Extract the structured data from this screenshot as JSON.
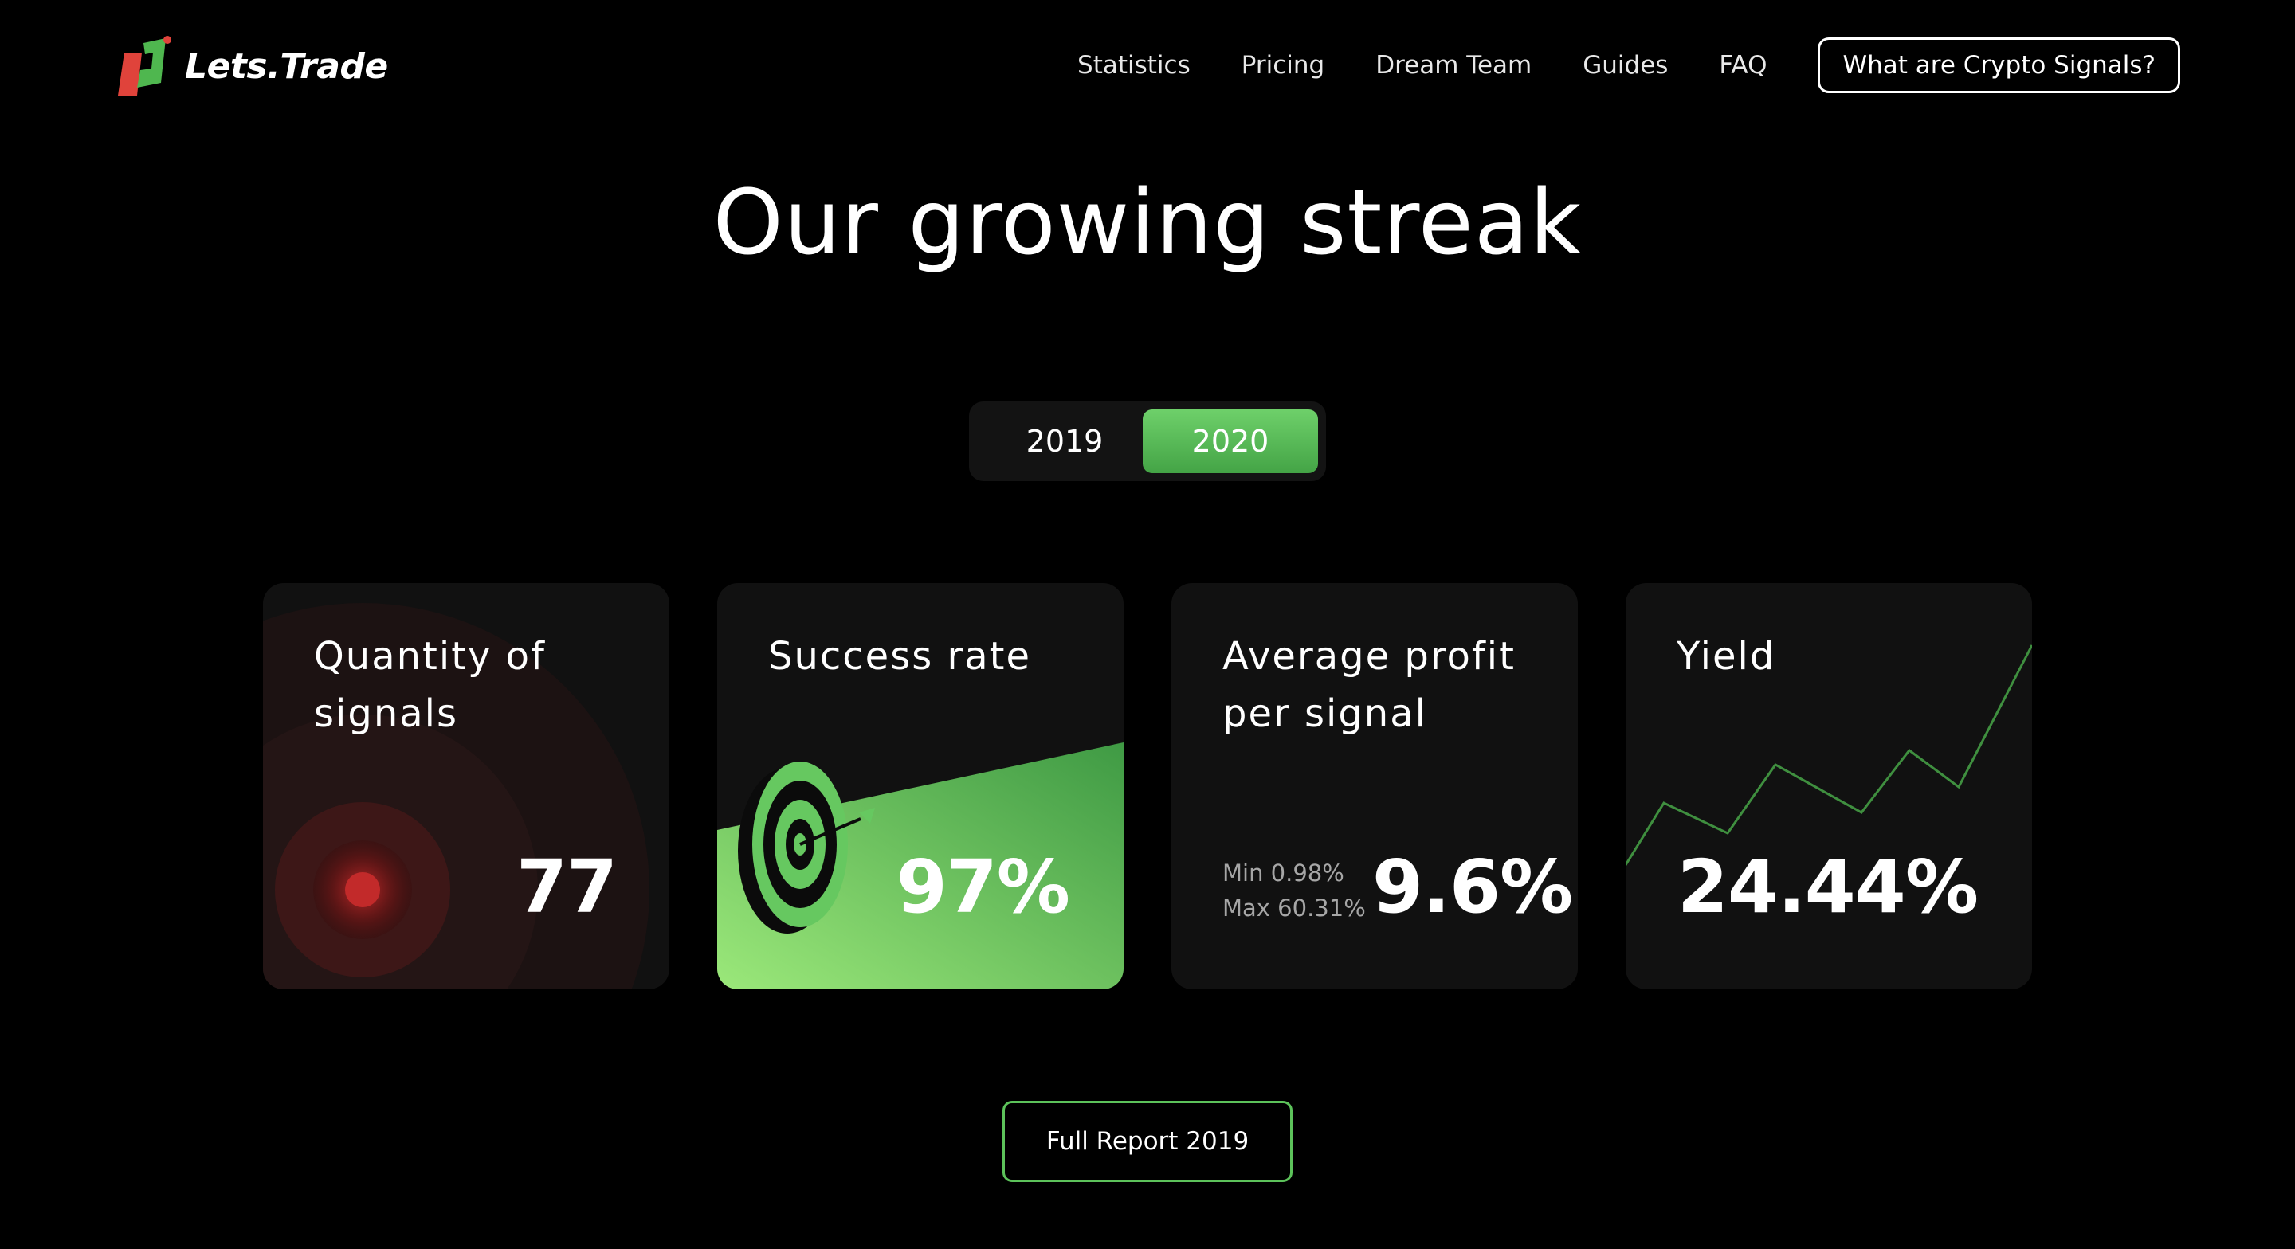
{
  "brand": {
    "name": "Lets.Trade"
  },
  "nav": {
    "links": [
      "Statistics",
      "Pricing",
      "Dream Team",
      "Guides",
      "FAQ"
    ],
    "cta": "What are Crypto Signals?"
  },
  "page_title": "Our growing streak",
  "years": {
    "options": [
      "2019",
      "2020"
    ],
    "selected": "2020"
  },
  "cards": [
    {
      "label": "Quantity of signals",
      "value": "77"
    },
    {
      "label": "Success rate",
      "value": "97%"
    },
    {
      "label": "Average profit per signal",
      "value": "9.6%",
      "min": "Min 0.98%",
      "max": "Max 60.31%"
    },
    {
      "label": "Yield",
      "value": "24.44%"
    }
  ],
  "report_button": "Full Report 2019",
  "colors": {
    "accent_green": "#5cc25a",
    "accent_red": "#e0433b",
    "background": "#000000",
    "card": "#111111"
  }
}
